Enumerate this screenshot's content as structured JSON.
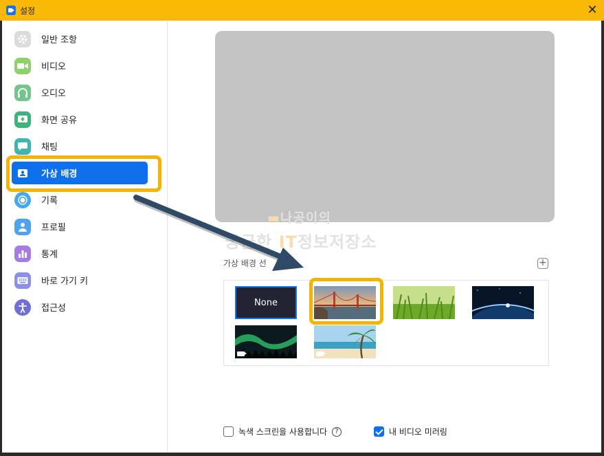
{
  "window": {
    "title": "설정",
    "close_glyph": "✕"
  },
  "sidebar": {
    "items": [
      {
        "label": "일반 조항",
        "icon": "gear-icon",
        "color": "#dcdcdc"
      },
      {
        "label": "비디오",
        "icon": "video-icon",
        "color": "#8fd16a"
      },
      {
        "label": "오디오",
        "icon": "headphones-icon",
        "color": "#72c58c"
      },
      {
        "label": "화면 공유",
        "icon": "share-screen-icon",
        "color": "#3fb27d"
      },
      {
        "label": "채팅",
        "icon": "chat-icon",
        "color": "#3bb6b0"
      },
      {
        "label": "가상 배경",
        "icon": "person-card-icon",
        "color": "#0e71eb",
        "active": true
      },
      {
        "label": "기록",
        "icon": "record-icon",
        "color": "#43a8f0"
      },
      {
        "label": "프로필",
        "icon": "profile-icon",
        "color": "#4ea3ef"
      },
      {
        "label": "통계",
        "icon": "statistics-icon",
        "color": "#a77be6"
      },
      {
        "label": "바로 가기 키",
        "icon": "keyboard-icon",
        "color": "#8b8fe8"
      },
      {
        "label": "접근성",
        "icon": "accessibility-icon",
        "color": "#6f6fd9"
      }
    ]
  },
  "main": {
    "watermark_line1_accent": "▬",
    "watermark_line1": "나공이의",
    "watermark_line2_a": "궁금한 ",
    "watermark_line2_accent": "IT",
    "watermark_line2_b": "정보저장소",
    "section_title": "가상 배경 선",
    "add_glyph": "+",
    "backgrounds": [
      {
        "label": "None",
        "name": "bg-none"
      },
      {
        "name": "bg-golden-gate",
        "selected_highlight": true
      },
      {
        "name": "bg-grass"
      },
      {
        "name": "bg-earth-space"
      },
      {
        "name": "bg-aurora",
        "is_video": true
      },
      {
        "name": "bg-beach-palm",
        "is_video": true
      }
    ],
    "options": {
      "green_screen_label": "녹색 스크린을 사용합니다",
      "green_screen_checked": false,
      "help_glyph": "?",
      "mirror_label": "내 비디오 미러링",
      "mirror_checked": true
    }
  },
  "colors": {
    "titlebar": "#fbb907",
    "highlight": "#f5b400",
    "accent": "#0e71eb",
    "arrow": "#2f4a66"
  }
}
